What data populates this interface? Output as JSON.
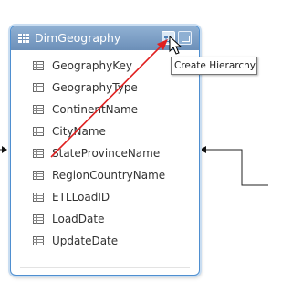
{
  "table": {
    "name": "DimGeography",
    "columns": [
      "GeographyKey",
      "GeographyType",
      "ContinentName",
      "CityName",
      "StateProvinceName",
      "RegionCountryName",
      "ETLLoadID",
      "LoadDate",
      "UpdateDate"
    ]
  },
  "tooltip": {
    "text": "Create Hierarchy"
  },
  "colors": {
    "header": "#7d9fc4",
    "border": "#4f8fd0",
    "arrow": "#e02020"
  }
}
